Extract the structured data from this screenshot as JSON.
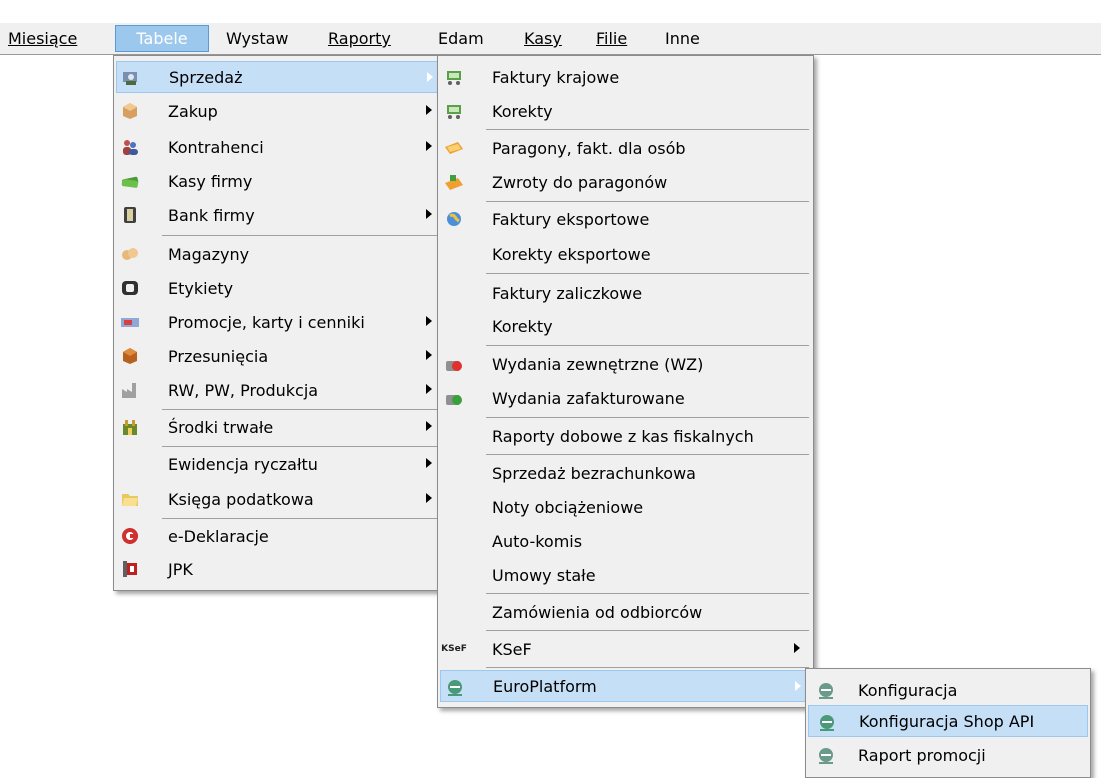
{
  "menubar": {
    "items": [
      "Miesiące",
      "Tabele",
      "Wystaw",
      "Raporty",
      "Edam",
      "Kasy",
      "Filie",
      "Inne"
    ]
  },
  "tabele_menu": {
    "items": [
      {
        "label": "Sprzedaż",
        "icon": "sales-icon"
      },
      {
        "label": "Zakup",
        "icon": "box-icon"
      },
      {
        "label": "Kontrahenci",
        "icon": "people-icon"
      },
      {
        "label": "Kasy firmy",
        "icon": "money-icon"
      },
      {
        "label": "Bank firmy",
        "icon": "bank-icon"
      },
      {
        "label": "Magazyny",
        "icon": "warehouse-icon"
      },
      {
        "label": "Etykiety",
        "icon": "label-printer-icon"
      },
      {
        "label": "Promocje, karty i cenniki",
        "icon": "card-icon"
      },
      {
        "label": "Przesunięcia",
        "icon": "package-icon"
      },
      {
        "label": "RW, PW, Produkcja",
        "icon": "factory-icon"
      },
      {
        "label": "Środki trwałe",
        "icon": "fixed-assets-icon"
      },
      {
        "label": "Ewidencja ryczałtu",
        "icon": ""
      },
      {
        "label": "Księga podatkowa",
        "icon": "folder-icon"
      },
      {
        "label": "e-Deklaracje",
        "icon": "e-declaration-icon"
      },
      {
        "label": "JPK",
        "icon": "jpk-icon"
      }
    ]
  },
  "sprzedaz_menu": {
    "items": [
      {
        "label": "Faktury krajowe",
        "icon": "cart-icon"
      },
      {
        "label": "Korekty",
        "icon": "cart-icon"
      },
      {
        "label": "Paragony, fakt. dla osób",
        "icon": "receipt-icon"
      },
      {
        "label": "Zwroty do paragonów",
        "icon": "return-icon"
      },
      {
        "label": "Faktury eksportowe",
        "icon": "globe-icon"
      },
      {
        "label": "Korekty eksportowe",
        "icon": ""
      },
      {
        "label": "Faktury zaliczkowe",
        "icon": ""
      },
      {
        "label": "Korekty",
        "icon": ""
      },
      {
        "label": "Wydania zewnętrzne (WZ)",
        "icon": "wz-icon"
      },
      {
        "label": "Wydania zafakturowane",
        "icon": "wz-invoiced-icon"
      },
      {
        "label": "Raporty dobowe z kas fiskalnych",
        "icon": ""
      },
      {
        "label": "Sprzedaż bezrachunkowa",
        "icon": ""
      },
      {
        "label": "Noty obciążeniowe",
        "icon": ""
      },
      {
        "label": "Auto-komis",
        "icon": ""
      },
      {
        "label": "Umowy stałe",
        "icon": ""
      },
      {
        "label": "Zamówienia od odbiorców",
        "icon": ""
      },
      {
        "label": "KSeF",
        "icon": "ksef-icon",
        "icon_text": "KSeF"
      },
      {
        "label": "EuroPlatform",
        "icon": "europlatform-icon"
      }
    ]
  },
  "europlatform_menu": {
    "items": [
      {
        "label": "Konfiguracja",
        "icon": "europlatform-icon"
      },
      {
        "label": "Konfiguracja Shop API",
        "icon": "europlatform-icon"
      },
      {
        "label": "Raport promocji",
        "icon": "europlatform-icon"
      }
    ]
  },
  "colors": {
    "menu_bg": "#f0f0f0",
    "highlight_bg": "#c5dff6",
    "active_menubar_bg": "#9cc8ee"
  }
}
